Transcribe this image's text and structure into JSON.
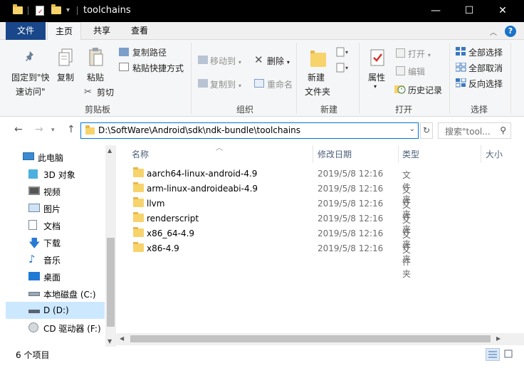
{
  "window": {
    "title": "toolchains",
    "minimize": "—",
    "maximize": "☐",
    "close": "✕"
  },
  "ribbon_tabs": {
    "file": "文件",
    "home": "主页",
    "share": "共享",
    "view": "查看"
  },
  "ribbon": {
    "clipboard": {
      "pin": "固定到\"快",
      "pin2": "速访问\"",
      "copy": "复制",
      "paste": "粘贴",
      "copy_path": "复制路径",
      "paste_shortcut": "粘贴快捷方式",
      "cut": "剪切",
      "label": "剪贴板"
    },
    "organize": {
      "move_to": "移动到",
      "copy_to": "复制到",
      "delete": "删除",
      "rename": "重命名",
      "label": "组织"
    },
    "new": {
      "new_folder": "新建",
      "new_folder2": "文件夹",
      "label": "新建"
    },
    "open": {
      "properties": "属性",
      "open": "打开",
      "edit": "编辑",
      "history": "历史记录",
      "label": "打开"
    },
    "select": {
      "select_all": "全部选择",
      "select_none": "全部取消",
      "invert": "反向选择",
      "label": "选择"
    }
  },
  "address": {
    "path": "D:\\SoftWare\\Android\\sdk\\ndk-bundle\\toolchains",
    "search_placeholder": "搜索\"tool...",
    "back": "←",
    "forward": "→",
    "up": "↑"
  },
  "nav_pane": {
    "items": [
      {
        "label": "此电脑",
        "icon": "computer-icon"
      },
      {
        "label": "3D 对象",
        "icon": "3d-objects-icon"
      },
      {
        "label": "视频",
        "icon": "video-icon"
      },
      {
        "label": "图片",
        "icon": "pictures-icon"
      },
      {
        "label": "文档",
        "icon": "documents-icon"
      },
      {
        "label": "下载",
        "icon": "download-icon"
      },
      {
        "label": "音乐",
        "icon": "music-icon"
      },
      {
        "label": "桌面",
        "icon": "desktop-icon"
      },
      {
        "label": "本地磁盘 (C:)",
        "icon": "local-disk-icon"
      },
      {
        "label": "D (D:)",
        "icon": "drive-icon"
      },
      {
        "label": "CD 驱动器 (F:)",
        "icon": "cd-drive-icon"
      }
    ]
  },
  "columns": {
    "name": "名称",
    "modified": "修改日期",
    "type": "类型",
    "size": "大小"
  },
  "files": [
    {
      "name": "aarch64-linux-android-4.9",
      "modified": "2019/5/8 12:16",
      "type": "文件夹"
    },
    {
      "name": "arm-linux-androideabi-4.9",
      "modified": "2019/5/8 12:16",
      "type": "文件夹"
    },
    {
      "name": "llvm",
      "modified": "2019/5/8 12:16",
      "type": "文件夹"
    },
    {
      "name": "renderscript",
      "modified": "2019/5/8 12:16",
      "type": "文件夹"
    },
    {
      "name": "x86_64-4.9",
      "modified": "2019/5/8 12:16",
      "type": "文件夹"
    },
    {
      "name": "x86-4.9",
      "modified": "2019/5/8 12:16",
      "type": "文件夹"
    }
  ],
  "status": {
    "count": "6 个项目"
  }
}
